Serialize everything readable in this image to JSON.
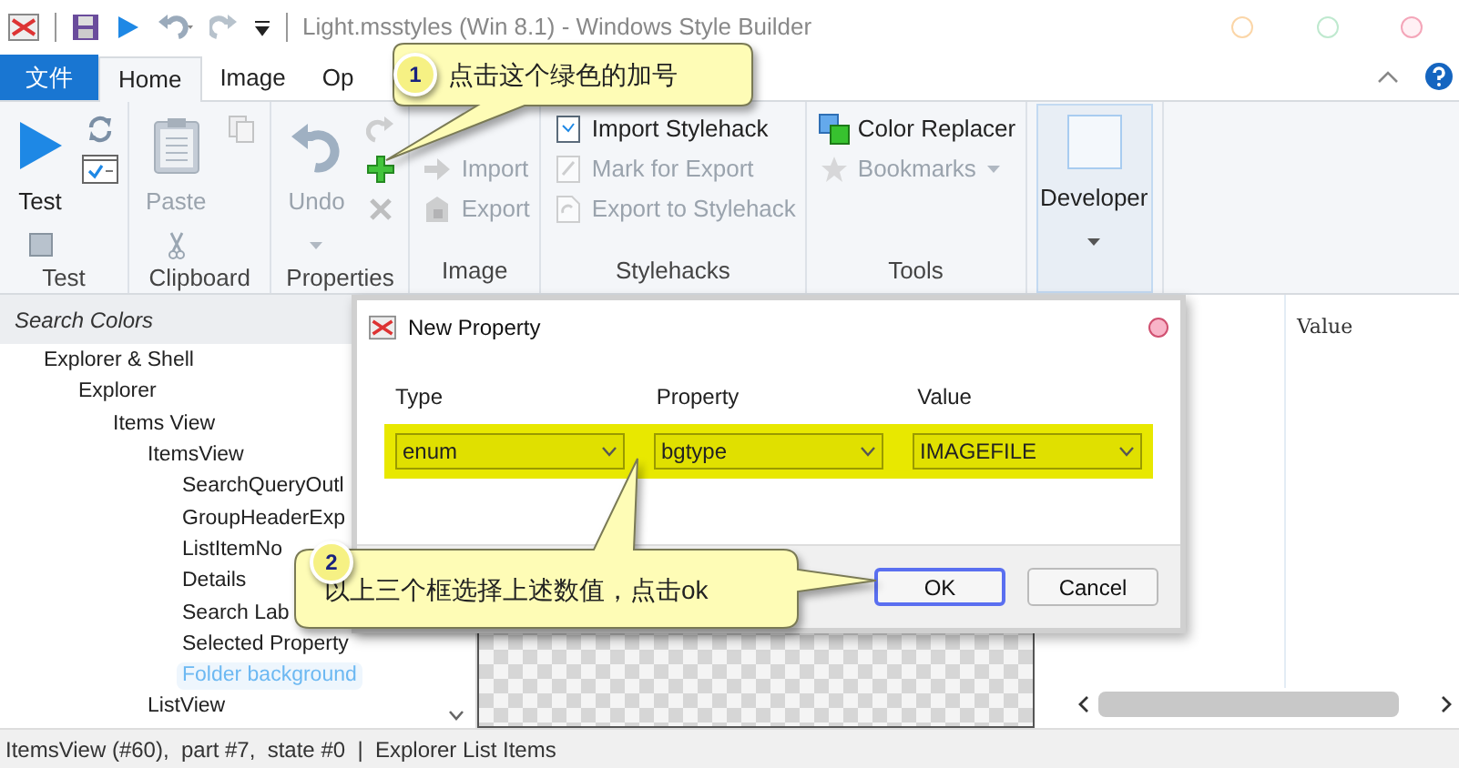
{
  "window": {
    "title": "Light.msstyles (Win 8.1) - Windows Style Builder"
  },
  "ribbon": {
    "tabs": [
      {
        "label": "文件",
        "kind": "file",
        "selected": false
      },
      {
        "label": "Home",
        "kind": "tab",
        "selected": true
      },
      {
        "label": "Image",
        "kind": "tab",
        "selected": false
      },
      {
        "label": "Op",
        "kind": "tab",
        "selected": false
      }
    ],
    "groups": [
      {
        "label": "Test",
        "large": {
          "label": "Test",
          "kind": "split",
          "disabled": false
        },
        "small": [
          {
            "kind": "icon",
            "disabled": false
          },
          {
            "kind": "icon",
            "disabled": false
          }
        ]
      },
      {
        "label": "Clipboard",
        "large": {
          "label": "Paste",
          "kind": "split",
          "disabled": true
        },
        "small": [
          {
            "kind": "icon",
            "disabled": true
          }
        ]
      },
      {
        "label": "Properties",
        "large": {
          "label": "Undo",
          "kind": "dropdown",
          "disabled": true
        },
        "small": [
          {
            "kind": "icon",
            "disabled": true
          },
          {
            "kind": "icon",
            "disabled": false
          },
          {
            "kind": "icon",
            "disabled": true
          }
        ]
      },
      {
        "label": "Image",
        "small": [
          {
            "label": "Import",
            "kind": "labeled",
            "disabled": true
          },
          {
            "label": "Export",
            "kind": "labeled",
            "disabled": true
          }
        ]
      },
      {
        "label": "Stylehacks",
        "small": [
          {
            "label": "Import Stylehack",
            "kind": "labeled",
            "disabled": false
          },
          {
            "label": "Mark for Export",
            "kind": "labeled",
            "disabled": true
          },
          {
            "label": "Export to Stylehack",
            "kind": "labeled",
            "disabled": true
          }
        ]
      },
      {
        "label": "Tools",
        "small": [
          {
            "label": "Color Replacer",
            "kind": "labeled",
            "disabled": false
          },
          {
            "label": "Bookmarks",
            "kind": "menu",
            "disabled": true
          }
        ]
      },
      {
        "large": {
          "label": "Developer",
          "kind": "dropdown",
          "disabled": false,
          "highlighted": true
        }
      }
    ]
  },
  "left_panel": {
    "search": {
      "placeholder": "Search Colors"
    },
    "tree": [
      {
        "label": "Explorer & Shell",
        "selected": false,
        "children": [
          {
            "label": "Explorer",
            "selected": false,
            "children": [
              {
                "label": "Items View",
                "selected": false,
                "children": [
                  {
                    "label": "ItemsView",
                    "selected": false,
                    "children": [
                      {
                        "label": "SearchQueryOutl",
                        "selected": false
                      },
                      {
                        "label": "GroupHeaderExp",
                        "selected": false
                      },
                      {
                        "label": "ListItemNo",
                        "selected": false
                      },
                      {
                        "label": "Details",
                        "selected": false
                      },
                      {
                        "label": "Search Lab",
                        "selected": false
                      },
                      {
                        "label": "Selected Property",
                        "selected": false
                      },
                      {
                        "label": "Folder background",
                        "selected": true
                      }
                    ]
                  },
                  {
                    "label": "ListView",
                    "selected": false
                  }
                ]
              }
            ]
          }
        ]
      }
    ]
  },
  "right_panel": {
    "columns": [
      "Value"
    ]
  },
  "dialog": {
    "title": "New Property",
    "fields": [
      {
        "label": "Type",
        "value": "enum"
      },
      {
        "label": "Property",
        "value": "bgtype"
      },
      {
        "label": "Value",
        "value": "IMAGEFILE"
      }
    ],
    "buttons": [
      {
        "label": "OK",
        "default": true
      },
      {
        "label": "Cancel",
        "default": false
      }
    ]
  },
  "annotations": [
    {
      "number": "1",
      "text": "点击这个绿色的加号"
    },
    {
      "number": "2",
      "text": "以上三个框选择上述数值，点击ok"
    }
  ],
  "status_bar": {
    "text": "ItemsView (#60),  part #7,  state #0  |  Explorer List Items"
  }
}
